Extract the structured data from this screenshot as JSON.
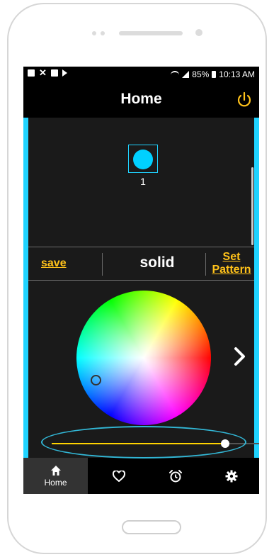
{
  "statusbar": {
    "battery": "85%",
    "time": "10:13 AM"
  },
  "appbar": {
    "title": "Home",
    "power_icon": "power-icon"
  },
  "devices": [
    {
      "label": "1",
      "color": "#00d0ff"
    }
  ],
  "mode_bar": {
    "save_label": "save",
    "mode_name": "solid",
    "set_pattern_label": "Set Pattern"
  },
  "brightness_slider": {
    "value_fraction": 0.83
  },
  "nav": {
    "items": [
      {
        "label": "Home",
        "icon": "home-icon"
      },
      {
        "label": "",
        "icon": "heart-icon"
      },
      {
        "label": "",
        "icon": "alarm-icon"
      },
      {
        "label": "",
        "icon": "gear-icon"
      }
    ]
  },
  "colors": {
    "accent": "#ffc21a",
    "edge": "#1fd3ff",
    "highlight": "#32b7d6"
  }
}
